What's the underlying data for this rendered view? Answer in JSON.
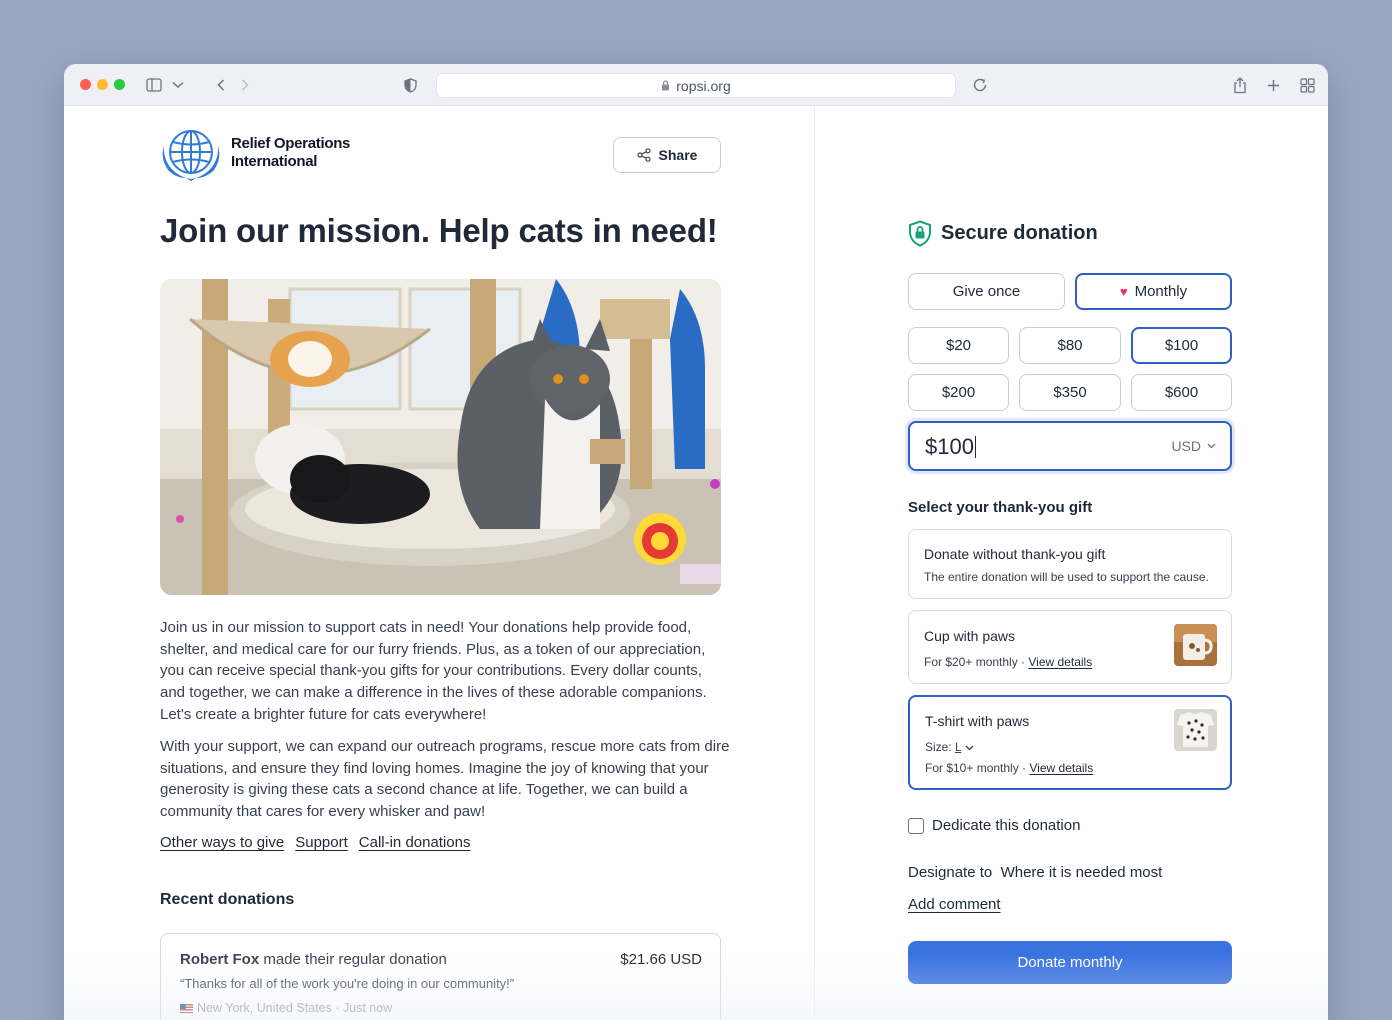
{
  "browser": {
    "url": "ropsi.org"
  },
  "org": {
    "name_line1": "Relief Operations",
    "name_line2": "International",
    "share_label": "Share"
  },
  "page": {
    "title": "Join our mission. Help cats in need!",
    "paragraph1": "Join us in our mission to support cats in need! Your donations help provide food, shelter, and medical care for our furry friends. Plus, as a token of our appreciation, you can receive special thank-you gifts for your contributions. Every dollar counts, and together, we can make a difference in the lives of these adorable companions. Let's create a brighter future for cats everywhere!",
    "paragraph2": "With your support, we can expand our outreach programs, rescue more cats from dire situations, and ensure they find loving homes. Imagine the joy of knowing that your generosity is giving these cats a second chance at life. Together, we can build a community that cares for every whisker and paw!",
    "links": [
      "Other ways to give",
      "Support",
      "Call-in donations"
    ]
  },
  "recent": {
    "title": "Recent donations",
    "items": [
      {
        "name": "Robert Fox",
        "action": "made their regular donation",
        "amount": "$21.66 USD",
        "quote": "“Thanks for all of the work you're doing in our community!”",
        "location": "New York, United States · Just now"
      }
    ]
  },
  "donation": {
    "secure_title": "Secure donation",
    "frequency": [
      "Give once",
      "Monthly"
    ],
    "selected_frequency": "Monthly",
    "amounts": [
      "$20",
      "$80",
      "$100",
      "$200",
      "$350",
      "$600"
    ],
    "selected_amount": "$100",
    "amount_value": "$100",
    "currency": "USD",
    "gift_title": "Select your thank-you gift",
    "gifts": [
      {
        "title": "Donate without thank-you gift",
        "desc": "The entire donation will be used to support the cause."
      },
      {
        "title": "Cup with paws",
        "desc": "For $20+ monthly",
        "link": "View details"
      },
      {
        "title": "T-shirt with paws",
        "size_label": "Size:",
        "size_value": "L",
        "desc": "For $10+ monthly",
        "link": "View details"
      }
    ],
    "selected_gift": "T-shirt with paws",
    "dedicate_label": "Dedicate this donation",
    "designate_label": "Designate to",
    "designate_value": "Where it is needed most",
    "add_comment": "Add comment",
    "submit_label": "Donate monthly",
    "colors": {
      "primary": "#3a73e0",
      "selected_border": "#2f5fc4",
      "heart": "#e8325b",
      "shield": "#16a37a"
    }
  }
}
